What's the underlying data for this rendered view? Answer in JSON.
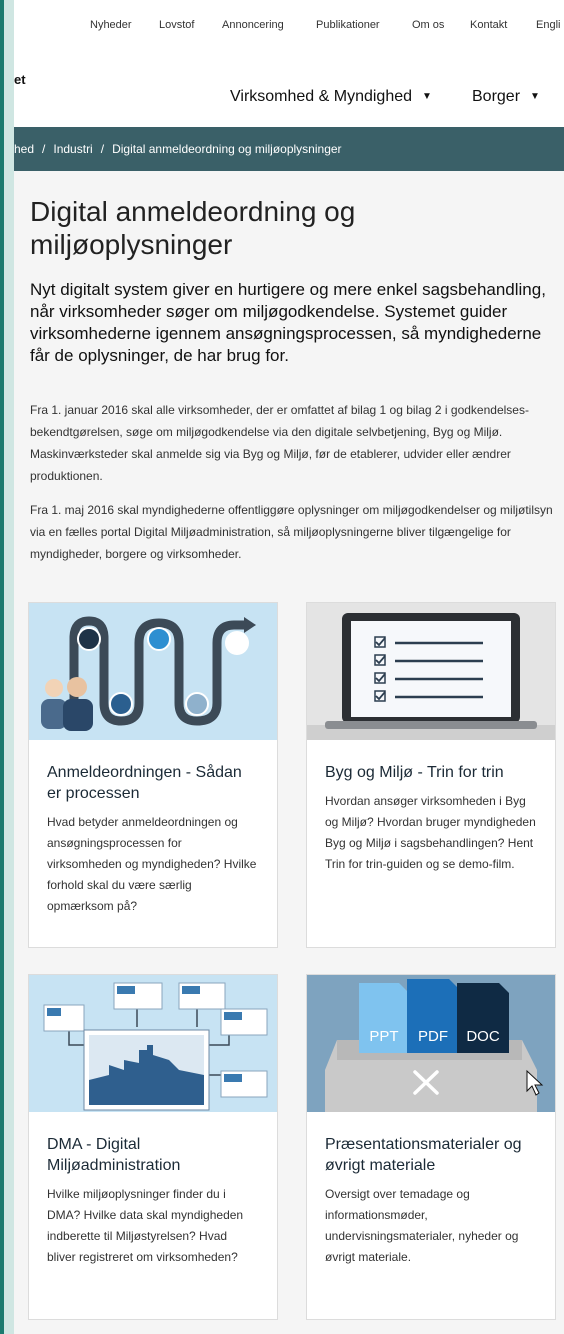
{
  "topnav": {
    "items": [
      "Nyheder",
      "Lovstof",
      "Annoncering",
      "Publikationer",
      "Om os",
      "Kontakt",
      "Engli"
    ]
  },
  "logo_fragment": "et",
  "mainnav": {
    "items": [
      {
        "label": "Virksomhed & Myndighed"
      },
      {
        "label": "Borger"
      }
    ]
  },
  "breadcrumb": {
    "items": [
      "hed",
      "Industri",
      "Digital anmeldeordning og miljøoplysninger"
    ],
    "separator": "/"
  },
  "page": {
    "title": "Digital anmeldeordning og miljøoplysninger",
    "lead": "Nyt digitalt system giver en hurtigere og mere enkel sagsbehandling, når virksomheder søger om miljøgodkendelse. Systemet guider virksomhederne igennem ansøgningsprocessen, så myndighederne får de oplysninger, de har brug for.",
    "paragraphs": [
      "Fra 1. januar 2016 skal alle virksomheder, der er omfattet af bilag 1 og bilag 2 i godkendelses-bekendtgørelsen, søge om miljøgodkendelse via den digitale selvbetjening, Byg og Miljø. Maskinværksteder skal anmelde sig via Byg og Miljø, før de etablerer, udvider eller ændrer produktionen.",
      "Fra 1. maj 2016 skal myndighederne offentliggøre oplysninger om miljøgodkendelser og miljøtilsyn via en fælles portal Digital Miljøadministration, så miljøoplysningerne bliver tilgængelige for myndigheder, borgere og virksomheder."
    ]
  },
  "cards": [
    {
      "title": "Anmeldeordningen - Sådan er processen",
      "text": "Hvad betyder anmeldeordningen og ansøgningsprocessen for virksomheden og myndigheden? Hvilke forhold skal du være særlig opmærksom på?",
      "icon": "process-flow-illustration"
    },
    {
      "title": "Byg og Miljø - Trin for trin",
      "text": "Hvordan ansøger virksomheden i Byg og Miljø? Hvordan bruger myndigheden Byg og Miljø i sagsbehandlingen? Hent Trin for trin-guiden og se demo-film.",
      "icon": "laptop-checklist-illustration"
    },
    {
      "title": "DMA - Digital Miljøadministration",
      "text": "Hvilke miljøoplysninger finder du i DMA? Hvilke data skal myndigheden indberette til Miljøstyrelsen? Hvad bliver registreret om virksomheden?",
      "icon": "network-documents-illustration"
    },
    {
      "title": "Præsentationsmaterialer og øvrigt materiale",
      "text": "Oversigt over temadage og informationsmøder, undervisningsmaterialer, nyheder og øvrigt materiale.",
      "icon": "file-types-illustration",
      "file_labels": [
        "PPT",
        "PDF",
        "DOC"
      ]
    }
  ],
  "colors": {
    "breadcrumb_bg": "#3a6068",
    "card_img_bg_light": "#c7e3f3",
    "card_img_bg_steel": "#7ea3bf",
    "side_bg": "#cfe6e2"
  }
}
